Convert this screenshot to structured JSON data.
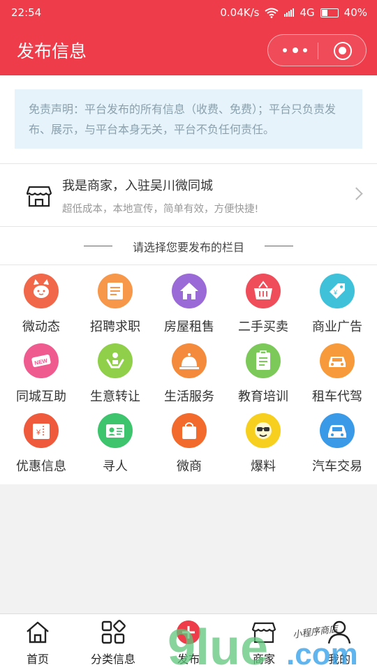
{
  "status_bar": {
    "time": "22:54",
    "speed": "0.04K/s",
    "network": "4G",
    "battery": "40%",
    "battery_fraction": 0.4
  },
  "header": {
    "title": "发布信息",
    "more_icon": "more-dots-icon",
    "close_icon": "target-icon"
  },
  "disclaimer": "免责声明：平台发布的所有信息（收费、免费）；平台只负责发布、展示，与平台本身无关，平台不负任何责任。",
  "merchant": {
    "title": "我是商家，入驻吴川微同城",
    "subtitle": "超低成本，本地宣传，简单有效，方便快捷!",
    "icon": "storefront-icon"
  },
  "section_title": "请选择您要发布的栏目",
  "categories": [
    {
      "label": "微动态",
      "icon": "cat-face-icon",
      "color": "#f0674a"
    },
    {
      "label": "招聘求职",
      "icon": "document-icon",
      "color": "#f7974a"
    },
    {
      "label": "房屋租售",
      "icon": "house-icon",
      "color": "#9a6ad6"
    },
    {
      "label": "二手买卖",
      "icon": "basket-icon",
      "color": "#ef4d5a"
    },
    {
      "label": "商业广告",
      "icon": "price-tag-icon",
      "color": "#3fc1d9"
    },
    {
      "label": "同城互助",
      "icon": "new-tag-icon",
      "color": "#ef5a8f"
    },
    {
      "label": "生意转让",
      "icon": "handshake-icon",
      "color": "#8fcf4a"
    },
    {
      "label": "生活服务",
      "icon": "service-bell-icon",
      "color": "#f48a3c"
    },
    {
      "label": "教育培训",
      "icon": "clipboard-icon",
      "color": "#7cc95a"
    },
    {
      "label": "租车代驾",
      "icon": "car-front-icon",
      "color": "#f79a3c"
    },
    {
      "label": "优惠信息",
      "icon": "coupon-icon",
      "color": "#ef5a3c"
    },
    {
      "label": "寻人",
      "icon": "id-card-icon",
      "color": "#3ec46d"
    },
    {
      "label": "微商",
      "icon": "shopping-bag-icon",
      "color": "#f26a2c"
    },
    {
      "label": "爆料",
      "icon": "smiley-glasses-icon",
      "color": "#f7cf1e"
    },
    {
      "label": "汽车交易",
      "icon": "car-icon",
      "color": "#3a9ae8"
    }
  ],
  "tabbar": [
    {
      "label": "首页",
      "icon": "home-icon"
    },
    {
      "label": "分类信息",
      "icon": "grid-icon"
    },
    {
      "label": "发布",
      "icon": "plus-circle-icon"
    },
    {
      "label": "商家",
      "icon": "store-icon"
    },
    {
      "label": "我的",
      "icon": "person-icon"
    }
  ],
  "watermark": {
    "text": "9lue.com",
    "script": "小程序商店"
  },
  "colors": {
    "brand_red": "#ee3c4a",
    "disclaimer_bg": "#e6f3fb",
    "watermark_green": "#5fc57c",
    "watermark_blue": "#3aa3ea"
  }
}
